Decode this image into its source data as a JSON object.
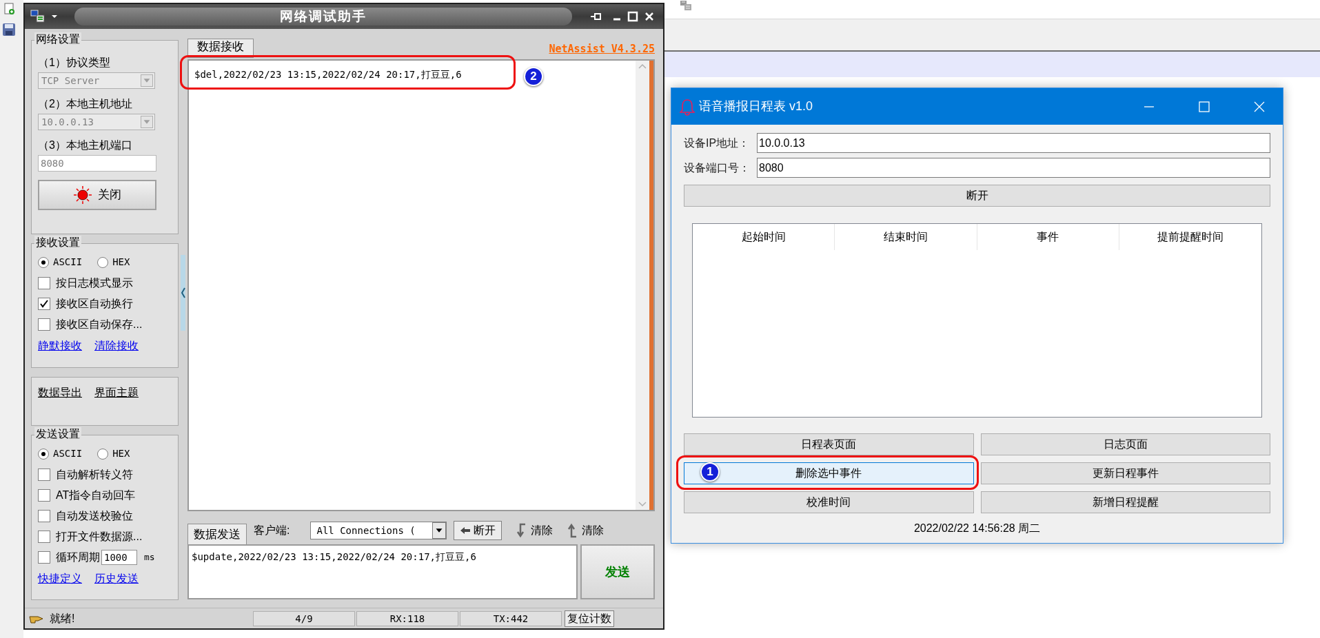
{
  "net_assist": {
    "title": "网络调试助手",
    "network_settings": {
      "legend": "网络设置",
      "fields": [
        {
          "label": "（1）协议类型",
          "value": "TCP Server",
          "kind": "select",
          "disabled": true
        },
        {
          "label": "（2）本地主机地址",
          "value": "10.0.0.13",
          "kind": "select",
          "disabled": true
        },
        {
          "label": "（3）本地主机端口",
          "value": "8080",
          "kind": "input",
          "disabled": true
        }
      ],
      "toggle_button": "关闭"
    },
    "receive_settings": {
      "legend": "接收设置",
      "modes": [
        {
          "label": "ASCII",
          "selected": true
        },
        {
          "label": "HEX",
          "selected": false
        }
      ],
      "options": [
        {
          "kind": "checkbox",
          "label": "按日志模式显示",
          "checked": false
        },
        {
          "kind": "checkbox",
          "label": "接收区自动换行",
          "checked": true
        },
        {
          "kind": "checkbox",
          "label": "接收区自动保存...",
          "checked": false
        }
      ],
      "links": [
        "静默接收",
        "清除接收"
      ]
    },
    "tools": {
      "links": [
        "数据导出",
        "界面主题"
      ]
    },
    "send_settings": {
      "legend": "发送设置",
      "modes": [
        {
          "label": "ASCII",
          "selected": true
        },
        {
          "label": "HEX",
          "selected": false
        }
      ],
      "options": [
        {
          "kind": "checkbox",
          "label": "自动解析转义符",
          "checked": false
        },
        {
          "kind": "checkbox",
          "label": "AT指令自动回车",
          "checked": false
        },
        {
          "kind": "checkbox",
          "label": "自动发送校验位",
          "checked": false
        },
        {
          "kind": "checkbox",
          "label": "打开文件数据源...",
          "checked": false
        },
        {
          "kind": "interval",
          "label": "循环周期",
          "checked": false,
          "value": "1000",
          "unit": "ms"
        }
      ],
      "links": [
        "快捷定义",
        "历史发送"
      ]
    },
    "receive_tab": "数据接收",
    "version": "NetAssist V4.3.25",
    "received_text": "$del,2022/02/23 13:15,2022/02/24 20:17,打豆豆,6",
    "send_bar": {
      "tab": "数据发送",
      "client_label": "客户端:",
      "client_value": "All Connections (",
      "disconnect_button": "断开",
      "clear_buttons": [
        "清除",
        "清除"
      ]
    },
    "send_text": "$update,2022/02/23 13:15,2022/02/24 20:17,打豆豆,6",
    "send_button": "发送",
    "status_bar": {
      "message": "就绪!",
      "counters": [
        "4/9",
        "RX:118",
        "TX:442"
      ],
      "reset_button": "复位计数"
    }
  },
  "scheduler": {
    "title": "语音播报日程表 v1.0",
    "fields": [
      {
        "label": "设备IP地址：",
        "value": "10.0.0.13"
      },
      {
        "label": "设备端口号：",
        "value": "8080"
      }
    ],
    "connect_button": "断开",
    "table": {
      "columns": [
        "起始时间",
        "结束时间",
        "事件",
        "提前提醒时间"
      ]
    },
    "buttons": [
      {
        "label": "日程表页面",
        "selected": false
      },
      {
        "label": "日志页面",
        "selected": false
      },
      {
        "label": "删除选中事件",
        "selected": true
      },
      {
        "label": "更新日程事件",
        "selected": false
      },
      {
        "label": "校准时间",
        "selected": false
      },
      {
        "label": "新增日程提醒",
        "selected": false
      }
    ],
    "datetime": "2022/02/22 14:56:28 周二"
  },
  "annotations": [
    {
      "number": "2"
    },
    {
      "number": "1"
    }
  ]
}
